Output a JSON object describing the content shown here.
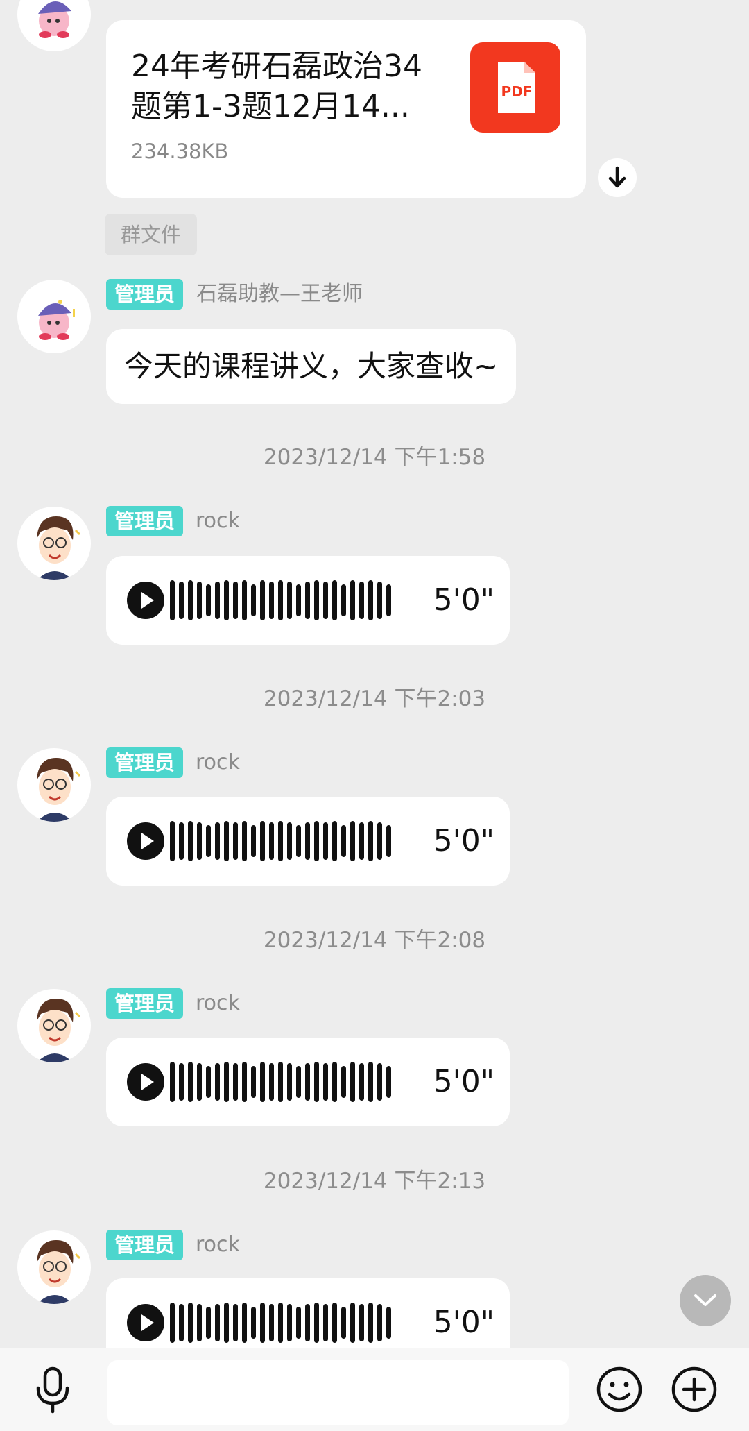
{
  "file_message": {
    "file_name": "24年考研石磊政治34题第1-3题12月14...",
    "file_size": "234.38KB",
    "file_type": "PDF",
    "source_tag": "群文件"
  },
  "messages": [
    {
      "badge": "管理员",
      "sender": "石磊助教—王老师",
      "text": "今天的课程讲义，大家查收~"
    }
  ],
  "voice_messages": [
    {
      "timestamp": "2023/12/14 下午1:58",
      "badge": "管理员",
      "sender": "rock",
      "duration": "5'0\""
    },
    {
      "timestamp": "2023/12/14 下午2:03",
      "badge": "管理员",
      "sender": "rock",
      "duration": "5'0\""
    },
    {
      "timestamp": "2023/12/14 下午2:08",
      "badge": "管理员",
      "sender": "rock",
      "duration": "5'0\""
    },
    {
      "timestamp": "2023/12/14 下午2:13",
      "badge": "管理员",
      "sender": "rock",
      "duration": "5'0\""
    }
  ],
  "input_bar": {
    "placeholder": "",
    "icons": [
      "microphone-icon",
      "emoji-icon",
      "plus-icon"
    ]
  },
  "colors": {
    "background": "#ededed",
    "admin_badge": "#4cd6cd",
    "pdf_red": "#f2381f"
  }
}
